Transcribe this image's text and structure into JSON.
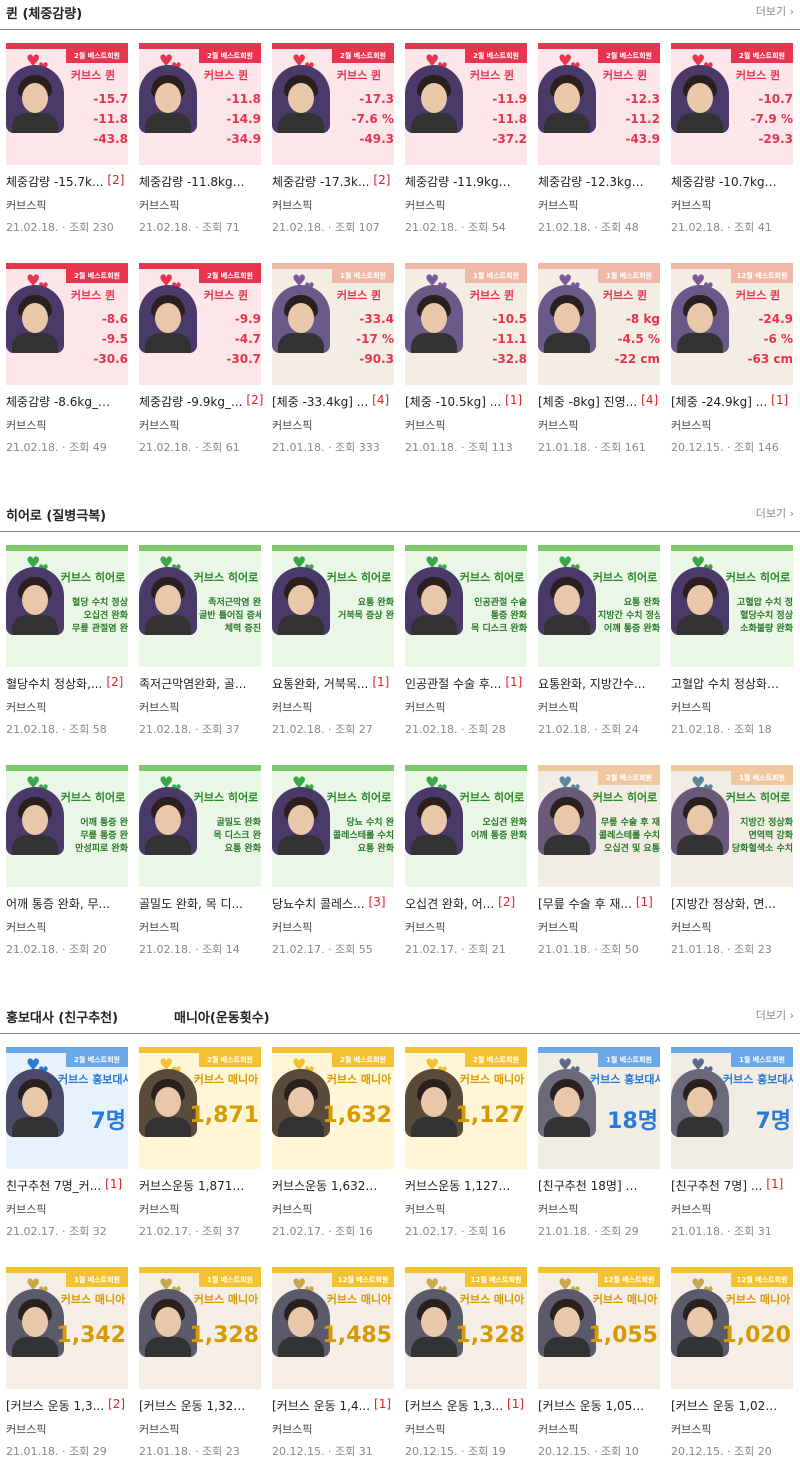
{
  "more_label": "더보기 ›",
  "sections": [
    {
      "title": "퀸 (체중감량)",
      "title2": ""
    },
    {
      "title": "히어로 (질병극복)",
      "title2": ""
    },
    {
      "title": "홍보대사 (친구추천)",
      "title2": "매니아(운동횟수)"
    }
  ],
  "colors": {
    "pink": "#e8344e",
    "green": "#3aa84a",
    "gold": "#e0a800",
    "blue": "#2a7ad8"
  },
  "cards": [
    {
      "caption": "체중감량 -15.7k...",
      "count": "[2]",
      "author": "커브스픽",
      "meta": "21.02.18. · 조회 230",
      "theme": "pink",
      "banner": "2월 베스트회원",
      "brand": "커브스 퀸",
      "stats": [
        "-15.7",
        "-11.8",
        "-43.8"
      ]
    },
    {
      "caption": "체중감량 -11.8kg_...",
      "count": "",
      "author": "커브스픽",
      "meta": "21.02.18. · 조회 71",
      "theme": "pink",
      "banner": "2월 베스트회원",
      "brand": "커브스 퀸",
      "stats": [
        "-11.8",
        "-14.9",
        "-34.9"
      ]
    },
    {
      "caption": "체중감량 -17.3k...",
      "count": "[2]",
      "author": "커브스픽",
      "meta": "21.02.18. · 조회 107",
      "theme": "pink",
      "banner": "2월 베스트회원",
      "brand": "커브스 퀸",
      "stats": [
        "-17.3",
        "-7.6 %",
        "-49.3"
      ]
    },
    {
      "caption": "체중감량 -11.9kg_...",
      "count": "",
      "author": "커브스픽",
      "meta": "21.02.18. · 조회 54",
      "theme": "pink",
      "banner": "2월 베스트회원",
      "brand": "커브스 퀸",
      "stats": [
        "-11.9",
        "-11.8",
        "-37.2"
      ]
    },
    {
      "caption": "체중감량 -12.3kg_...",
      "count": "",
      "author": "커브스픽",
      "meta": "21.02.18. · 조회 48",
      "theme": "pink",
      "banner": "2월 베스트회원",
      "brand": "커브스 퀸",
      "stats": [
        "-12.3",
        "-11.2",
        "-43.9"
      ]
    },
    {
      "caption": "체중감량 -10.7kg_...",
      "count": "",
      "author": "커브스픽",
      "meta": "21.02.18. · 조회 41",
      "theme": "pink",
      "banner": "2월 베스트회원",
      "brand": "커브스 퀸",
      "stats": [
        "-10.7",
        "-7.9 %",
        "-29.3"
      ]
    },
    {
      "caption": "체중감량 -8.6kg_커...",
      "count": "",
      "author": "커브스픽",
      "meta": "21.02.18. · 조회 49",
      "theme": "pink",
      "banner": "2월 베스트회원",
      "brand": "커브스 퀸",
      "stats": [
        "-8.6",
        "-9.5",
        "-30.6"
      ]
    },
    {
      "caption": "체중감량 -9.9kg_...",
      "count": "[2]",
      "author": "커브스픽",
      "meta": "21.02.18. · 조회 61",
      "theme": "pink",
      "banner": "2월 베스트회원",
      "brand": "커브스 퀸",
      "stats": [
        "-9.9",
        "-4.7",
        "-30.7"
      ]
    },
    {
      "caption": "[체중 -33.4kg] ...",
      "count": "[4]",
      "author": "커브스픽",
      "meta": "21.01.18. · 조회 333",
      "theme": "pink2",
      "banner": "1월 베스트회원",
      "brand": "커브스 퀸",
      "stats": [
        "-33.4",
        "-17 %",
        "-90.3"
      ]
    },
    {
      "caption": "[체중 -10.5kg] ...",
      "count": "[1]",
      "author": "커브스픽",
      "meta": "21.01.18. · 조회 113",
      "theme": "pink2",
      "banner": "1월 베스트회원",
      "brand": "커브스 퀸",
      "stats": [
        "-10.5",
        "-11.1",
        "-32.8"
      ]
    },
    {
      "caption": "[체중 -8kg] 진영...",
      "count": "[4]",
      "author": "커브스픽",
      "meta": "21.01.18. · 조회 161",
      "theme": "pink2",
      "banner": "1월 베스트회원",
      "brand": "커브스 퀸",
      "stats": [
        "-8 kg",
        "-4.5 %",
        "-22 cm"
      ]
    },
    {
      "caption": "[체중 -24.9kg] ...",
      "count": "[1]",
      "author": "커브스픽",
      "meta": "20.12.15. · 조회 146",
      "theme": "pink2",
      "banner": "12월 베스트회원",
      "brand": "커브스 퀸",
      "stats": [
        "-24.9",
        "-6 %",
        "-63 cm"
      ]
    },
    {
      "caption": "혈당수치 정상화,...",
      "count": "[2]",
      "author": "커브스픽",
      "meta": "21.02.18. · 조회 58",
      "theme": "green",
      "banner": "",
      "brand": "커브스 히어로",
      "lines": [
        "혈당 수치 정상",
        "오십견 완화",
        "무릎 관절염 완"
      ]
    },
    {
      "caption": "족저근막염완화, 골...",
      "count": "",
      "author": "커브스픽",
      "meta": "21.02.18. · 조회 37",
      "theme": "green",
      "banner": "",
      "brand": "커브스 히어로",
      "lines": [
        "족저근막염 완",
        "골반 틀어짐 증세",
        "체력 증진"
      ]
    },
    {
      "caption": "요통완화, 거북목...",
      "count": "[1]",
      "author": "커브스픽",
      "meta": "21.02.18. · 조회 27",
      "theme": "green",
      "banner": "",
      "brand": "커브스 히어로",
      "lines": [
        "요통 완화",
        "거북목 증상 완"
      ]
    },
    {
      "caption": "인공관절 수술 후...",
      "count": "[1]",
      "author": "커브스픽",
      "meta": "21.02.18. · 조회 28",
      "theme": "green",
      "banner": "",
      "brand": "커브스 히어로",
      "lines": [
        "인공관절 수술",
        "통증 완화",
        "목 디스크 완화"
      ]
    },
    {
      "caption": "요통완화, 지방간수...",
      "count": "",
      "author": "커브스픽",
      "meta": "21.02.18. · 조회 24",
      "theme": "green",
      "banner": "",
      "brand": "커브스 히어로",
      "lines": [
        "요통 완화",
        "지방간 수치 정상",
        "어깨 통증 완화"
      ]
    },
    {
      "caption": "고혈압 수치 정상화,...",
      "count": "",
      "author": "커브스픽",
      "meta": "21.02.18. · 조회 18",
      "theme": "green",
      "banner": "",
      "brand": "커브스 히어로",
      "lines": [
        "고혈압 수치 정",
        "혈당수치 정상",
        "소화불량 완화"
      ]
    },
    {
      "caption": "어깨 통증 완화, 무...",
      "count": "",
      "author": "커브스픽",
      "meta": "21.02.18. · 조회 20",
      "theme": "green",
      "banner": "",
      "brand": "커브스 히어로",
      "lines": [
        "어깨 통증 완",
        "무릎 통증 완",
        "만성피로 완화"
      ]
    },
    {
      "caption": "골밀도 완화, 목 디...",
      "count": "",
      "author": "커브스픽",
      "meta": "21.02.18. · 조회 14",
      "theme": "green",
      "banner": "",
      "brand": "커브스 히어로",
      "lines": [
        "골밀도 완화",
        "목 디스크 완",
        "요통 완화"
      ]
    },
    {
      "caption": "당뇨수치 콜레스...",
      "count": "[3]",
      "author": "커브스픽",
      "meta": "21.02.17. · 조회 55",
      "theme": "green",
      "banner": "",
      "brand": "커브스 히어로",
      "lines": [
        "당뇨 수치 완",
        "콜레스테롤 수치",
        "요통 완화"
      ]
    },
    {
      "caption": "오십견 완화, 어...",
      "count": "[2]",
      "author": "커브스픽",
      "meta": "21.02.17. · 조회 21",
      "theme": "green",
      "banner": "",
      "brand": "커브스 히어로",
      "lines": [
        "오십견 완화",
        "어깨 통증 완화"
      ]
    },
    {
      "caption": "[무릎 수술 후 재...",
      "count": "[1]",
      "author": "커브스픽",
      "meta": "21.01.18. · 조회 50",
      "theme": "green2",
      "banner": "2월 베스트회원",
      "brand": "커브스 히어로",
      "lines": [
        "무릎 수술 후 재",
        "콜레스테롤 수치",
        "오십견 및 요통"
      ]
    },
    {
      "caption": "[지방간 정상화, 면...",
      "count": "",
      "author": "커브스픽",
      "meta": "21.01.18. · 조회 23",
      "theme": "green2",
      "banner": "1월 베스트회원",
      "brand": "커브스 히어로",
      "lines": [
        "지방간 정상화",
        "면역력 강화",
        "당화혈색소 수치"
      ]
    },
    {
      "caption": "친구추천 7명_커...",
      "count": "[1]",
      "author": "커브스픽",
      "meta": "21.02.17. · 조회 32",
      "theme": "blue",
      "banner": "2월 베스트회원",
      "brand": "커브스 홍보대사",
      "big": "7명"
    },
    {
      "caption": "커브스운동 1,871회...",
      "count": "",
      "author": "커브스픽",
      "meta": "21.02.17. · 조회 37",
      "theme": "gold",
      "banner": "2월 베스트회원",
      "brand": "커브스 매니아",
      "big": "1,871"
    },
    {
      "caption": "커브스운동 1,632회...",
      "count": "",
      "author": "커브스픽",
      "meta": "21.02.17. · 조회 16",
      "theme": "gold",
      "banner": "2월 베스트회원",
      "brand": "커브스 매니아",
      "big": "1,632"
    },
    {
      "caption": "커브스운동 1,127회...",
      "count": "",
      "author": "커브스픽",
      "meta": "21.02.17. · 조회 16",
      "theme": "gold",
      "banner": "2월 베스트회원",
      "brand": "커브스 매니아",
      "big": "1,127"
    },
    {
      "caption": "[친구추천 18명] 가...",
      "count": "",
      "author": "커브스픽",
      "meta": "21.01.18. · 조회 29",
      "theme": "blue2",
      "banner": "1월 베스트회원",
      "brand": "커브스 홍보대사",
      "big": "18명"
    },
    {
      "caption": "[친구추천 7명] ...",
      "count": "[1]",
      "author": "커브스픽",
      "meta": "21.01.18. · 조회 31",
      "theme": "blue2",
      "banner": "1월 베스트회원",
      "brand": "커브스 홍보대사",
      "big": "7명"
    },
    {
      "caption": "[커브스 운동 1,3...",
      "count": "[2]",
      "author": "커브스픽",
      "meta": "21.01.18. · 조회 29",
      "theme": "gold2",
      "banner": "1월 베스트회원",
      "brand": "커브스 매니아",
      "big": "1,342"
    },
    {
      "caption": "[커브스 운동 1,328...",
      "count": "",
      "author": "커브스픽",
      "meta": "21.01.18. · 조회 23",
      "theme": "gold2",
      "banner": "1월 베스트회원",
      "brand": "커브스 매니아",
      "big": "1,328"
    },
    {
      "caption": "[커브스 운동 1,4...",
      "count": "[1]",
      "author": "커브스픽",
      "meta": "20.12.15. · 조회 31",
      "theme": "gold2",
      "banner": "12월 베스트회원",
      "brand": "커브스 매니아",
      "big": "1,485"
    },
    {
      "caption": "[커브스 운동 1,3...",
      "count": "[1]",
      "author": "커브스픽",
      "meta": "20.12.15. · 조회 19",
      "theme": "gold2",
      "banner": "12월 베스트회원",
      "brand": "커브스 매니아",
      "big": "1,328"
    },
    {
      "caption": "[커브스 운동 1,055...",
      "count": "",
      "author": "커브스픽",
      "meta": "20.12.15. · 조회 10",
      "theme": "gold2",
      "banner": "12월 베스트회원",
      "brand": "커브스 매니아",
      "big": "1,055"
    },
    {
      "caption": "[커브스 운동 1,020...",
      "count": "",
      "author": "커브스픽",
      "meta": "20.12.15. · 조회 20",
      "theme": "gold2",
      "banner": "12월 베스트회원",
      "brand": "커브스 매니아",
      "big": "1,020"
    }
  ]
}
